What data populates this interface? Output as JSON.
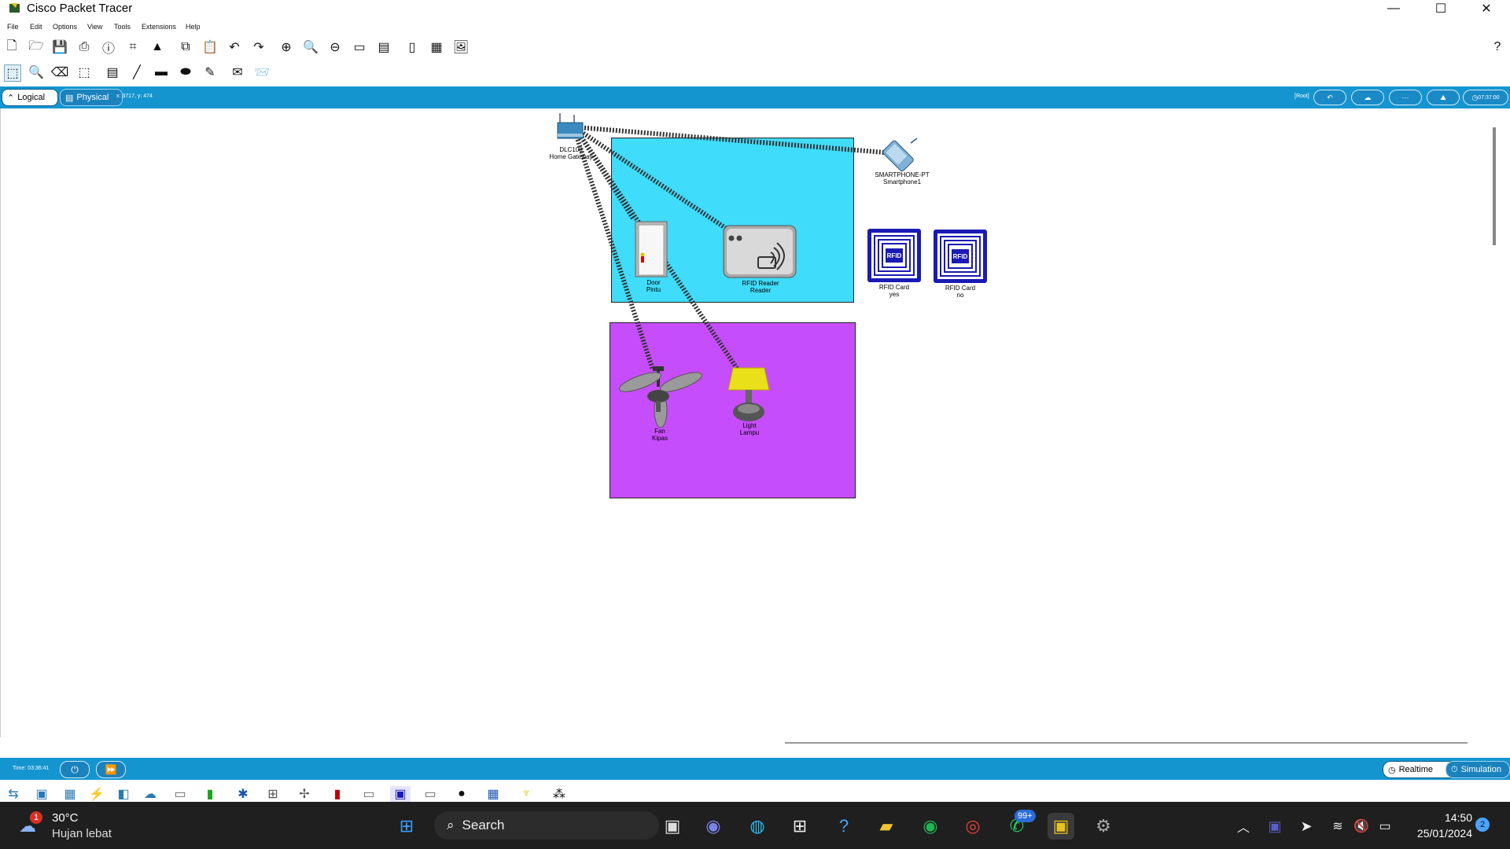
{
  "window": {
    "title": "Cisco Packet Tracer"
  },
  "menu": [
    "File",
    "Edit",
    "Options",
    "View",
    "Tools",
    "Extensions",
    "Help"
  ],
  "workspace_tabs": {
    "logical": "Logical",
    "physical": "Physical",
    "coords": "x: 3717, y: 474"
  },
  "top_right": {
    "root": "[Root]",
    "clock": "07:37:00"
  },
  "devices": {
    "gateway": {
      "type": "DLC100",
      "name": "Home Gateway"
    },
    "smartphone": {
      "type": "SMARTPHONE-PT",
      "name": "Smartphone1"
    },
    "door": {
      "type": "Door",
      "name": "Pintu"
    },
    "rfid_reader": {
      "type": "RFID Reader",
      "name": "Reader"
    },
    "rfid_card_yes": {
      "type": "RFID Card",
      "name": "yes",
      "chip": "RFID"
    },
    "rfid_card_no": {
      "type": "RFID Card",
      "name": "no",
      "chip": "RFID"
    },
    "fan": {
      "type": "Fan",
      "name": "Kipas"
    },
    "light": {
      "type": "Light",
      "name": "Lampu"
    }
  },
  "simbar": {
    "time": "Time: 03:36:41",
    "realtime": "Realtime",
    "simulation": "Simulation"
  },
  "taskbar": {
    "weather_temp": "30°C",
    "weather_desc": "Hujan lebat",
    "weather_badge": "1",
    "search": "Search",
    "whatsapp_badge": "99+",
    "time": "14:50",
    "date": "25/01/2024",
    "notif_count": "2"
  },
  "colors": {
    "accent_bar": "#1495d0",
    "cyan_cluster": "#3fdcfc",
    "magenta_cluster": "#c64dfb"
  }
}
